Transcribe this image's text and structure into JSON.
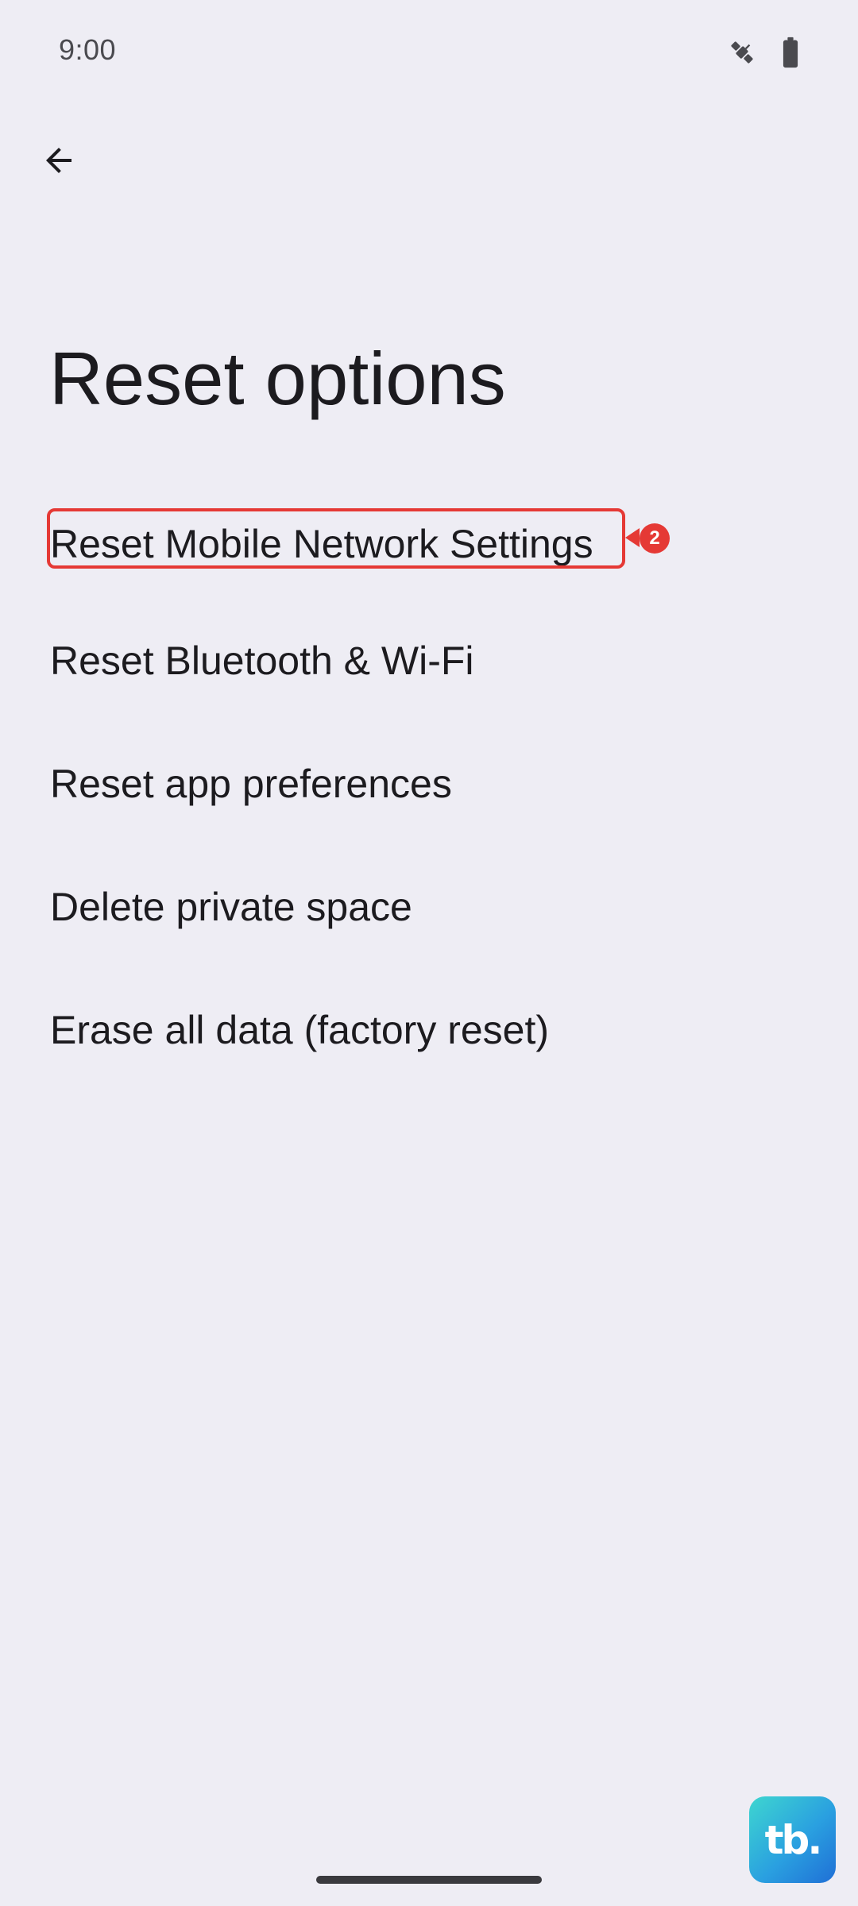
{
  "status_bar": {
    "time": "9:00",
    "icons": [
      "satellite-icon",
      "battery-icon"
    ]
  },
  "header": {
    "back_icon": "arrow-left-icon",
    "title": "Reset options"
  },
  "options": [
    {
      "label": "Reset Mobile Network Settings"
    },
    {
      "label": "Reset Bluetooth & Wi-Fi"
    },
    {
      "label": "Reset app preferences"
    },
    {
      "label": "Delete private space"
    },
    {
      "label": "Erase all data (factory reset)"
    }
  ],
  "annotation": {
    "step_number": "2",
    "color": "#e53935"
  },
  "brand": {
    "logo_text": "tb."
  },
  "colors": {
    "background": "#eeedf4",
    "text": "#1c1b1f",
    "accent": "#e53935"
  }
}
